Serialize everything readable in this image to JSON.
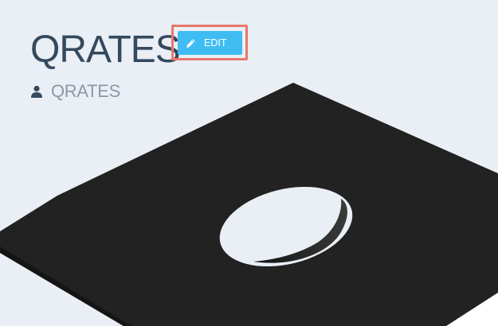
{
  "header": {
    "title": "QRATES",
    "edit_label": "EDIT",
    "owner_name": "QRATES"
  },
  "icons": {
    "edit": "pencil-icon",
    "owner": "user-icon"
  },
  "colors": {
    "background": "#e9eff5",
    "title": "#34495e",
    "edit_button": "#3fbdf3",
    "highlight": "#e8776a",
    "record": "#222222"
  }
}
